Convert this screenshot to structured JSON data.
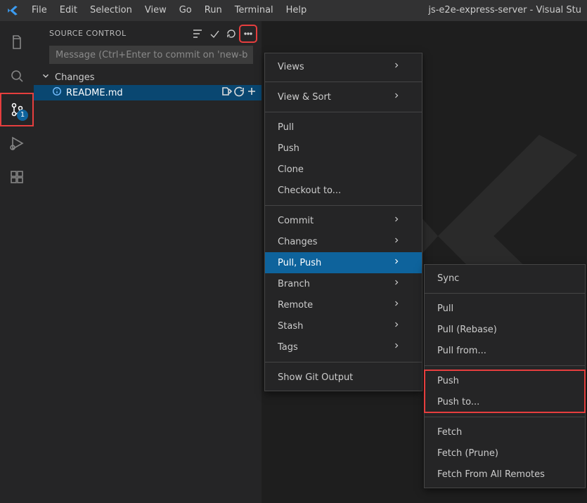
{
  "window": {
    "title": "js-e2e-express-server - Visual Stu"
  },
  "menubar": {
    "items": [
      "File",
      "Edit",
      "Selection",
      "View",
      "Go",
      "Run",
      "Terminal",
      "Help"
    ]
  },
  "activity": {
    "icons": [
      "files",
      "search",
      "source-control",
      "run-debug",
      "extensions"
    ],
    "active_index": 2,
    "scm_badge": "1"
  },
  "scm_panel": {
    "title": "SOURCE CONTROL",
    "commit_placeholder": "Message (Ctrl+Enter to commit on 'new-b",
    "changes_label": "Changes",
    "file": {
      "name": "README.md"
    }
  },
  "context_menu": {
    "groups": [
      [
        "Views"
      ],
      [
        "View & Sort"
      ],
      [
        "Pull",
        "Push",
        "Clone",
        "Checkout to..."
      ],
      [
        "Commit",
        "Changes",
        "Pull, Push",
        "Branch",
        "Remote",
        "Stash",
        "Tags"
      ],
      [
        "Show Git Output"
      ]
    ],
    "submenu_on": "Pull, Push",
    "has_arrow": [
      "Views",
      "View & Sort",
      "Commit",
      "Changes",
      "Pull, Push",
      "Branch",
      "Remote",
      "Stash",
      "Tags"
    ]
  },
  "submenu": {
    "groups": [
      [
        "Sync"
      ],
      [
        "Pull",
        "Pull (Rebase)",
        "Pull from..."
      ],
      [
        "Push",
        "Push to..."
      ],
      [
        "Fetch",
        "Fetch (Prune)",
        "Fetch From All Remotes"
      ]
    ],
    "highlight_group_index": 2
  }
}
